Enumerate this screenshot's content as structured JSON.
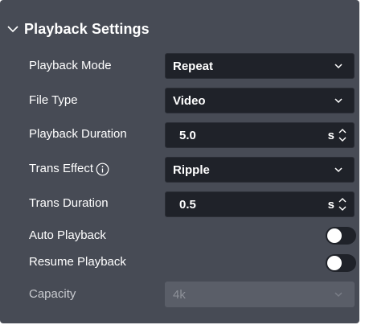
{
  "panel": {
    "title": "Playback Settings",
    "collapse_icon": "chevron-down-icon"
  },
  "rows": {
    "playback_mode": {
      "label": "Playback Mode",
      "value": "Repeat",
      "icon": "chevron-down-icon"
    },
    "file_type": {
      "label": "File Type",
      "value": "Video",
      "icon": "chevron-down-icon"
    },
    "playback_duration": {
      "label": "Playback Duration",
      "value": "5.0",
      "unit": "s",
      "icon": "stepper-icon"
    },
    "trans_effect": {
      "label": "Trans Effect",
      "value": "Ripple",
      "info_icon": "info-icon",
      "icon": "chevron-down-icon"
    },
    "trans_duration": {
      "label": "Trans Duration",
      "value": "0.5",
      "unit": "s",
      "icon": "stepper-icon"
    },
    "auto_playback": {
      "label": "Auto Playback",
      "enabled": false
    },
    "resume_playback": {
      "label": "Resume Playback",
      "enabled": false
    },
    "capacity": {
      "label": "Capacity",
      "value": "4k",
      "disabled": true,
      "icon": "chevron-down-icon"
    }
  },
  "colors": {
    "panel_bg": "#474b55",
    "field_bg": "#1f2229",
    "disabled_field_bg": "#5a5e68",
    "text": "#ffffff"
  }
}
